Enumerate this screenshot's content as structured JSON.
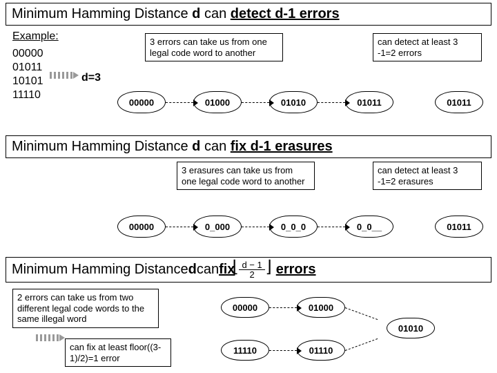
{
  "section1": {
    "title_pre": "Minimum Hamming Distance ",
    "title_d": "d",
    "title_mid": " can ",
    "title_emph": "detect d-1 errors",
    "example_label": "Example:",
    "codewords": [
      "00000",
      "01011",
      "10101",
      "11110"
    ],
    "d_label": "d=3",
    "note_left": "3 errors can take us from one legal code word to another",
    "note_right": "can detect at least 3 -1=2 errors",
    "sequence": [
      "00000",
      "01000",
      "01010",
      "01011",
      "01011"
    ]
  },
  "section2": {
    "title_pre": "Minimum Hamming Distance ",
    "title_d": "d",
    "title_mid": " can ",
    "title_emph": "fix d-1 erasures",
    "note_left": "3 erasures can take us from one legal code word to another",
    "note_right": "can detect at least 3 -1=2 erasures",
    "sequence": [
      "00000",
      "0_000",
      "0_0_0",
      "0_0__",
      "01011"
    ]
  },
  "section3": {
    "title_pre": "Minimum Hamming Distance ",
    "title_d": "d",
    "title_mid": " can ",
    "title_fix": "fix",
    "frac_num": "d − 1",
    "frac_den": "2",
    "title_tail": "errors",
    "note_top": "2 errors can take us from two different legal code words to the same illegal word",
    "note_bottom": "can fix at least floor((3-1)/2)=1 error",
    "row1": [
      "00000",
      "01000"
    ],
    "row2": [
      "11110",
      "01110"
    ],
    "merge": "01010"
  },
  "chart_data": {
    "type": "table",
    "title": "Hamming distance properties (d=3)",
    "codewords": [
      "00000",
      "01011",
      "10101",
      "11110"
    ],
    "minimum_hamming_distance": 3,
    "detectable_errors": 2,
    "correctable_erasures": 2,
    "correctable_errors": 1,
    "detect_sequence": [
      "00000",
      "01000",
      "01010",
      "01011",
      "01011"
    ],
    "erasure_sequence": [
      "00000",
      "0_000",
      "0_0_0",
      "0_0__",
      "01011"
    ],
    "error_merge_paths": {
      "from": [
        "00000",
        "11110"
      ],
      "via": [
        "01000",
        "01110"
      ],
      "collide_at": "01010"
    }
  }
}
